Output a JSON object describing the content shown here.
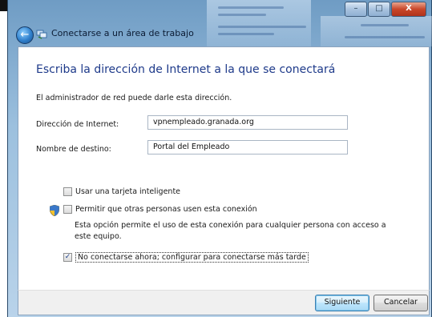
{
  "window": {
    "title": "Conectarse a un área de trabajo",
    "caption_buttons": {
      "minimize": "–",
      "maximize": "□",
      "close": "X"
    }
  },
  "main": {
    "heading": "Escriba la dirección de Internet a la que se conectará",
    "info": "El administrador de red puede darle esta dirección.",
    "internet_address": {
      "label": "Dirección de Internet:",
      "value": "vpnempleado.granada.org"
    },
    "destination_name": {
      "label": "Nombre de destino:",
      "value": "Portal del Empleado"
    },
    "options": [
      {
        "label": "Usar una tarjeta inteligente",
        "checked": false
      },
      {
        "label": "Permitir que otras personas usen esta conexión",
        "checked": false
      },
      {
        "label": "No conectarse ahora; configurar para conectarse más tarde",
        "checked": true
      }
    ],
    "allow_description": "Esta opción permite el uso de esta conexión para cualquier persona con acceso a este equipo."
  },
  "footer": {
    "next_label": "Siguiente",
    "cancel_label": "Cancelar"
  },
  "colors": {
    "heading": "#1e3a8a",
    "frame": "#9cc0de",
    "footer": "#f0f0f0"
  },
  "icons": {
    "back": "back-arrow-icon",
    "network": "network-icon",
    "shield": "uac-shield-icon"
  }
}
